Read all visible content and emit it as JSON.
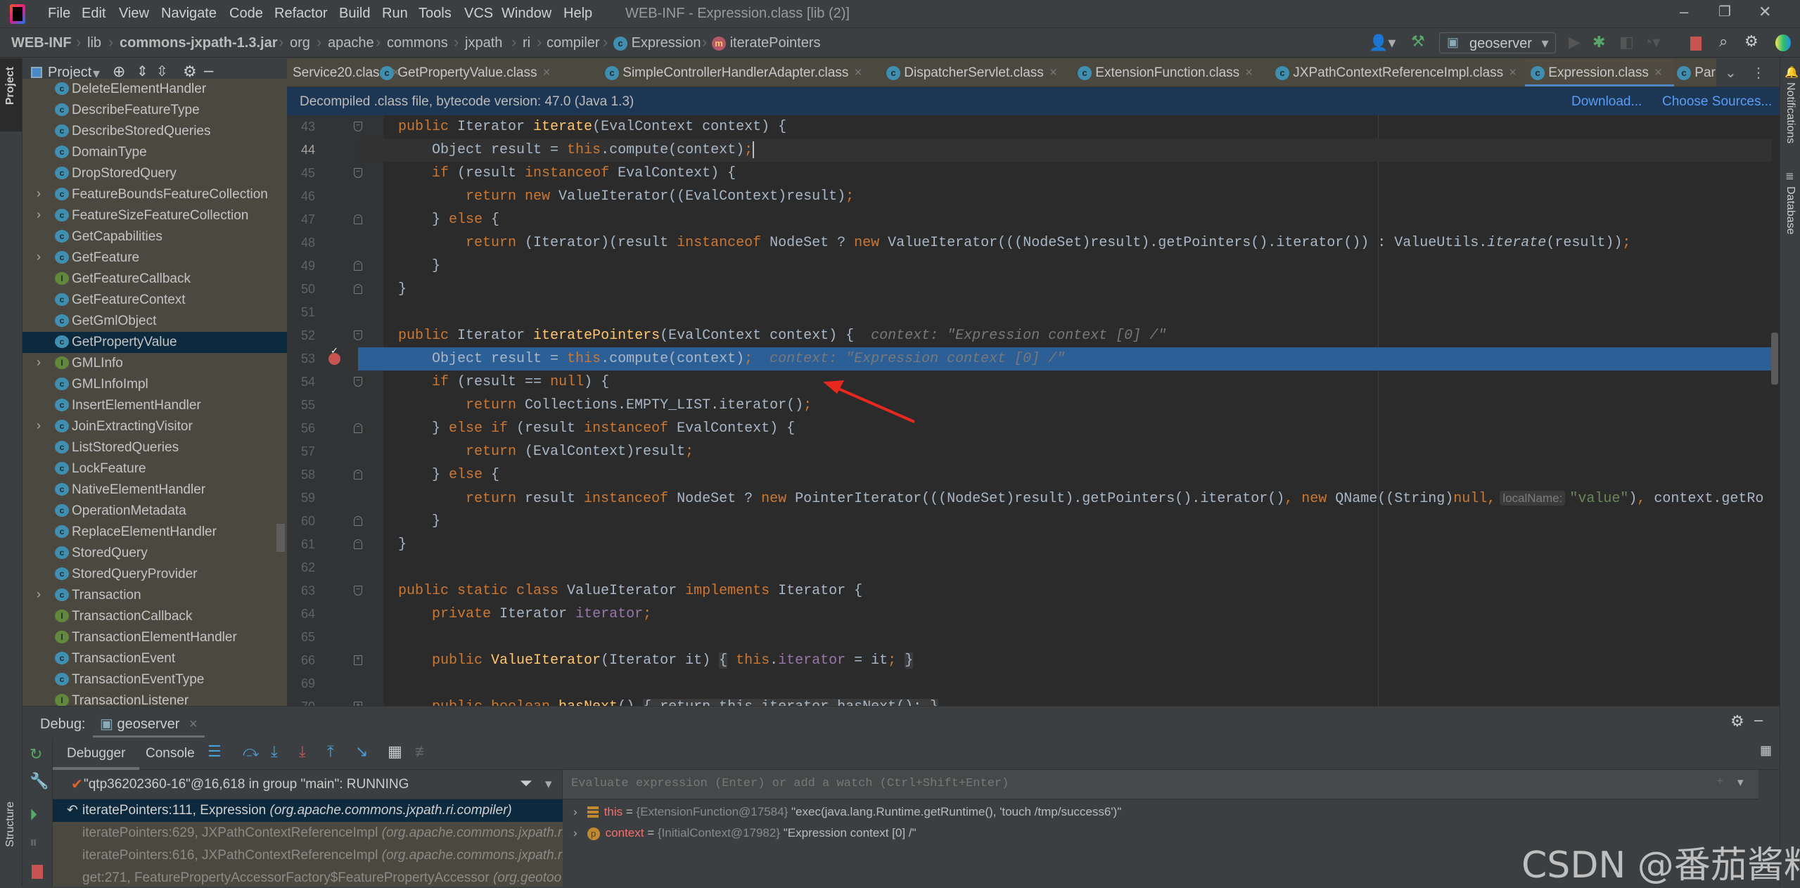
{
  "app": {
    "title": "WEB-INF - Expression.class [lib (2)]"
  },
  "menu": [
    "File",
    "Edit",
    "View",
    "Navigate",
    "Code",
    "Refactor",
    "Build",
    "Run",
    "Tools",
    "VCS",
    "Window",
    "Help"
  ],
  "breadcrumb": [
    "WEB-INF",
    "lib",
    "commons-jxpath-1.3.jar",
    "org",
    "apache",
    "commons",
    "jxpath",
    "ri",
    "compiler",
    "Expression",
    "iteratePointers"
  ],
  "toolbar": {
    "run_config": "geoserver"
  },
  "left_stripe": {
    "project": "Project",
    "structure": "Structure"
  },
  "right_stripe": {
    "notifications": "Notifications",
    "database": "Database"
  },
  "project": {
    "title": "Project",
    "items": [
      {
        "label": "DeleteElementHandler",
        "kind": "class",
        "expandable": false
      },
      {
        "label": "DescribeFeatureType",
        "kind": "class",
        "expandable": false
      },
      {
        "label": "DescribeStoredQueries",
        "kind": "class",
        "expandable": false
      },
      {
        "label": "DomainType",
        "kind": "class",
        "expandable": false
      },
      {
        "label": "DropStoredQuery",
        "kind": "class",
        "expandable": false
      },
      {
        "label": "FeatureBoundsFeatureCollection",
        "kind": "class",
        "expandable": true
      },
      {
        "label": "FeatureSizeFeatureCollection",
        "kind": "class",
        "expandable": true
      },
      {
        "label": "GetCapabilities",
        "kind": "class",
        "expandable": false
      },
      {
        "label": "GetFeature",
        "kind": "class",
        "expandable": true
      },
      {
        "label": "GetFeatureCallback",
        "kind": "interface",
        "expandable": false
      },
      {
        "label": "GetFeatureContext",
        "kind": "class",
        "expandable": false
      },
      {
        "label": "GetGmlObject",
        "kind": "class",
        "expandable": false
      },
      {
        "label": "GetPropertyValue",
        "kind": "class",
        "expandable": false,
        "selected": true
      },
      {
        "label": "GMLInfo",
        "kind": "interface",
        "expandable": true
      },
      {
        "label": "GMLInfoImpl",
        "kind": "class",
        "expandable": false
      },
      {
        "label": "InsertElementHandler",
        "kind": "class",
        "expandable": false
      },
      {
        "label": "JoinExtractingVisitor",
        "kind": "class",
        "expandable": true
      },
      {
        "label": "ListStoredQueries",
        "kind": "class",
        "expandable": false
      },
      {
        "label": "LockFeature",
        "kind": "class",
        "expandable": false
      },
      {
        "label": "NativeElementHandler",
        "kind": "class",
        "expandable": false
      },
      {
        "label": "OperationMetadata",
        "kind": "class",
        "expandable": false
      },
      {
        "label": "ReplaceElementHandler",
        "kind": "class",
        "expandable": false
      },
      {
        "label": "StoredQuery",
        "kind": "class",
        "expandable": false
      },
      {
        "label": "StoredQueryProvider",
        "kind": "class",
        "expandable": false
      },
      {
        "label": "Transaction",
        "kind": "class",
        "expandable": true
      },
      {
        "label": "TransactionCallback",
        "kind": "interface",
        "expandable": false
      },
      {
        "label": "TransactionElementHandler",
        "kind": "interface",
        "expandable": false
      },
      {
        "label": "TransactionEvent",
        "kind": "class",
        "expandable": false
      },
      {
        "label": "TransactionEventType",
        "kind": "class",
        "expandable": false
      },
      {
        "label": "TransactionListener",
        "kind": "interface",
        "expandable": false
      }
    ]
  },
  "tabs": [
    {
      "label": "Service20.class"
    },
    {
      "label": "GetPropertyValue.class"
    },
    {
      "label": "SimpleControllerHandlerAdapter.class"
    },
    {
      "label": "DispatcherServlet.class"
    },
    {
      "label": "ExtensionFunction.class"
    },
    {
      "label": "JXPathContextReferenceImpl.class"
    },
    {
      "label": "Expression.class",
      "active": true
    },
    {
      "label": "Par"
    }
  ],
  "banner": {
    "text": "Decompiled .class file, bytecode version: 47.0 (Java 1.3)",
    "download": "Download...",
    "choose_sources": "Choose Sources..."
  },
  "editor": {
    "lines": [
      {
        "n": "43",
        "indent": 0,
        "fold": "open",
        "tokens": [
          [
            "kw",
            "public "
          ],
          [
            "t",
            "Iterator "
          ],
          [
            "m",
            "iterate"
          ],
          [
            "t",
            "(EvalContext context) {"
          ]
        ]
      },
      {
        "n": "44",
        "indent": 4,
        "caret": true,
        "tokens": [
          [
            "t",
            "Object result = "
          ],
          [
            "kw",
            "this"
          ],
          [
            "t",
            ".compute(context)"
          ],
          [
            "kw",
            ";"
          ]
        ]
      },
      {
        "n": "45",
        "indent": 4,
        "fold": "open",
        "tokens": [
          [
            "kw",
            "if "
          ],
          [
            "t",
            "(result "
          ],
          [
            "kw",
            "instanceof "
          ],
          [
            "t",
            "EvalContext) {"
          ]
        ]
      },
      {
        "n": "46",
        "indent": 8,
        "tokens": [
          [
            "kw",
            "return new "
          ],
          [
            "t",
            "ValueIterator((EvalContext)result)"
          ],
          [
            "kw",
            ";"
          ]
        ]
      },
      {
        "n": "47",
        "indent": 4,
        "fold": "close",
        "tokens": [
          [
            "t",
            "} "
          ],
          [
            "kw",
            "else "
          ],
          [
            "t",
            "{"
          ]
        ]
      },
      {
        "n": "48",
        "indent": 8,
        "tokens": [
          [
            "kw",
            "return "
          ],
          [
            "t",
            "(Iterator)(result "
          ],
          [
            "kw",
            "instanceof "
          ],
          [
            "t",
            "NodeSet ? "
          ],
          [
            "kw",
            "new "
          ],
          [
            "t",
            "ValueIterator(((NodeSet)result).getPointers().iterator()) : ValueUtils."
          ],
          [
            "it",
            "iterate"
          ],
          [
            "t",
            "(result))"
          ],
          [
            "kw",
            ";"
          ]
        ]
      },
      {
        "n": "49",
        "indent": 4,
        "fold": "close",
        "tokens": [
          [
            "t",
            "}"
          ]
        ]
      },
      {
        "n": "50",
        "indent": 0,
        "fold": "close",
        "tokens": [
          [
            "t",
            "}"
          ]
        ]
      },
      {
        "n": "51",
        "indent": 0,
        "tokens": []
      },
      {
        "n": "52",
        "indent": 0,
        "fold": "open",
        "tokens": [
          [
            "kw",
            "public "
          ],
          [
            "t",
            "Iterator "
          ],
          [
            "m",
            "iteratePointers"
          ],
          [
            "t",
            "(EvalContext context) {"
          ],
          [
            "hint",
            "context: \"Expression context [0] /\""
          ]
        ]
      },
      {
        "n": "53",
        "indent": 4,
        "exec": true,
        "breakpoint": true,
        "tokens": [
          [
            "t",
            "Object result = "
          ],
          [
            "kw",
            "this"
          ],
          [
            "t",
            ".compute(context)"
          ],
          [
            "kw",
            ";"
          ],
          [
            "hint",
            "context: \"Expression context [0] /\""
          ]
        ]
      },
      {
        "n": "54",
        "indent": 4,
        "fold": "open",
        "tokens": [
          [
            "kw",
            "if "
          ],
          [
            "t",
            "(result == "
          ],
          [
            "kw",
            "null"
          ],
          [
            "t",
            ") {"
          ]
        ]
      },
      {
        "n": "55",
        "indent": 8,
        "tokens": [
          [
            "kw",
            "return "
          ],
          [
            "t",
            "Collections.EMPTY_LIST.iterator()"
          ],
          [
            "kw",
            ";"
          ]
        ]
      },
      {
        "n": "56",
        "indent": 4,
        "fold": "close",
        "tokens": [
          [
            "t",
            "} "
          ],
          [
            "kw",
            "else if "
          ],
          [
            "t",
            "(result "
          ],
          [
            "kw",
            "instanceof "
          ],
          [
            "t",
            "EvalContext) {"
          ]
        ]
      },
      {
        "n": "57",
        "indent": 8,
        "tokens": [
          [
            "kw",
            "return "
          ],
          [
            "t",
            "(EvalContext)result"
          ],
          [
            "kw",
            ";"
          ]
        ]
      },
      {
        "n": "58",
        "indent": 4,
        "fold": "close",
        "tokens": [
          [
            "t",
            "} "
          ],
          [
            "kw",
            "else "
          ],
          [
            "t",
            "{"
          ]
        ]
      },
      {
        "n": "59",
        "indent": 8,
        "tokens": [
          [
            "kw",
            "return "
          ],
          [
            "t",
            "result "
          ],
          [
            "kw",
            "instanceof "
          ],
          [
            "t",
            "NodeSet ? "
          ],
          [
            "kw",
            "new "
          ],
          [
            "t",
            "PointerIterator(((NodeSet)result).getPointers().iterator()"
          ],
          [
            "kw",
            ", new "
          ],
          [
            "t",
            "QName((String)"
          ],
          [
            "kw",
            "null,"
          ],
          [
            "pill",
            "localName:"
          ],
          [
            "str",
            "\"value\""
          ],
          [
            "t",
            ")"
          ],
          [
            "kw",
            ", "
          ],
          [
            "t",
            "context.getRo"
          ]
        ]
      },
      {
        "n": "60",
        "indent": 4,
        "fold": "close",
        "tokens": [
          [
            "t",
            "}"
          ]
        ]
      },
      {
        "n": "61",
        "indent": 0,
        "fold": "close",
        "tokens": [
          [
            "t",
            "}"
          ]
        ]
      },
      {
        "n": "62",
        "indent": 0,
        "tokens": []
      },
      {
        "n": "63",
        "indent": 0,
        "fold": "open",
        "tokens": [
          [
            "kw",
            "public static class "
          ],
          [
            "t",
            "ValueIterator "
          ],
          [
            "kw",
            "implements "
          ],
          [
            "t",
            "Iterator {"
          ]
        ]
      },
      {
        "n": "64",
        "indent": 4,
        "tokens": [
          [
            "kw",
            "private "
          ],
          [
            "t",
            "Iterator "
          ],
          [
            "f",
            "iterator"
          ],
          [
            "kw",
            ";"
          ]
        ]
      },
      {
        "n": "65",
        "indent": 0,
        "tokens": []
      },
      {
        "n": "66",
        "indent": 4,
        "fold": "collapsed",
        "tokens": [
          [
            "kw",
            "public "
          ],
          [
            "m",
            "ValueIterator"
          ],
          [
            "t",
            "(Iterator it) "
          ],
          [
            "fbox",
            "{"
          ],
          [
            "kw",
            " this"
          ],
          [
            "t",
            "."
          ],
          [
            "f",
            "iterator"
          ],
          [
            "t",
            " = it"
          ],
          [
            "kw",
            "; "
          ],
          [
            "fbox",
            "}"
          ]
        ]
      },
      {
        "n": "69",
        "indent": 0,
        "tokens": []
      },
      {
        "n": "70",
        "indent": 4,
        "fold": "collapsed",
        "tokens": [
          [
            "kw",
            "public boolean "
          ],
          [
            "m",
            "hasNext"
          ],
          [
            "t",
            "() "
          ],
          [
            "fbox",
            "{ return this.iterator.hasNext(); }"
          ]
        ]
      }
    ]
  },
  "debug": {
    "label": "Debug:",
    "session": "geoserver",
    "tabs": [
      "Debugger",
      "Console"
    ],
    "thread": "\"qtp36202360-16\"@16,618 in group \"main\": RUNNING",
    "frames": [
      {
        "method": "iteratePointers:111, Expression",
        "pkg": "(org.apache.commons.jxpath.ri.compiler)",
        "selected": true
      },
      {
        "method": "iteratePointers:629, JXPathContextReferenceImpl",
        "pkg": "(org.apache.commons.jxpath.ri"
      },
      {
        "method": "iteratePointers:616, JXPathContextReferenceImpl",
        "pkg": "(org.apache.commons.jxpath.ri"
      },
      {
        "method": "get:271, FeaturePropertyAccessorFactory$FeaturePropertyAccessor",
        "pkg": "(org.geotoo"
      }
    ],
    "evaluate_placeholder": "Evaluate expression (Enter) or add a watch (Ctrl+Shift+Enter)",
    "variables": [
      {
        "name": "this",
        "ref": "{ExtensionFunction@17584}",
        "value": "\"exec(java.lang.Runtime.getRuntime(), 'touch /tmp/success6')\"",
        "icon": "field-icon"
      },
      {
        "name": "context",
        "ref": "{InitialContext@17982}",
        "value": "\"Expression context [0] /\"",
        "icon": "parameter-icon"
      }
    ]
  },
  "watermark": "CSDN @番茄酱料",
  "colors": {
    "keyword": "#cc7832",
    "method": "#ffc66d",
    "field": "#9876aa",
    "string": "#6a8759",
    "exec_line": "#2d5f97",
    "breakpoint": "#c75450",
    "annotation_arrow": "#e8281e"
  }
}
